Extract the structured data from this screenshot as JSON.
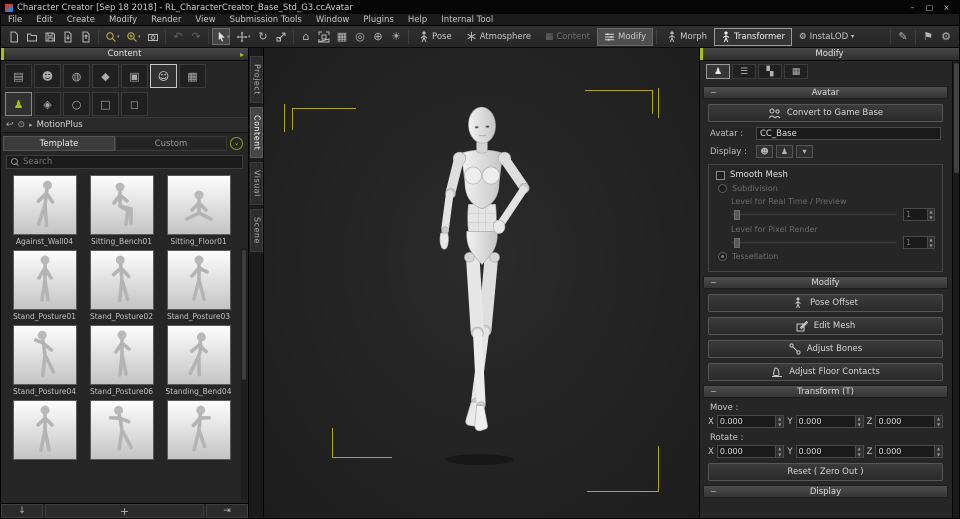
{
  "window": {
    "title": "Character Creator [Sep 18 2018] - RL_CharacterCreator_Base_Std_G3.ccAvatar",
    "controls": {
      "minimize": "–",
      "maximize": "▢",
      "close": "×"
    }
  },
  "menu": {
    "items": [
      "File",
      "Edit",
      "Create",
      "Modify",
      "Render",
      "View",
      "Submission Tools",
      "Window",
      "Plugins",
      "Help",
      "Internal Tool"
    ]
  },
  "toolbar": {
    "pose": "Pose",
    "atmosphere": "Atmosphere",
    "content": "Content",
    "modify": "Modify",
    "morph": "Morph",
    "transformer": "Transformer",
    "instalod": "InstaLOD"
  },
  "left_panel": {
    "header": "Content",
    "breadcrumb": "MotionPlus",
    "tabs": {
      "template": "Template",
      "custom": "Custom"
    },
    "search_placeholder": "Search",
    "items": [
      {
        "label": "Against_Wall04"
      },
      {
        "label": "Sitting_Bench01"
      },
      {
        "label": "Sitting_Floor01"
      },
      {
        "label": "Stand_Posture01"
      },
      {
        "label": "Stand_Posture02"
      },
      {
        "label": "Stand_Posture03"
      },
      {
        "label": "Stand_Posture04"
      },
      {
        "label": "Stand_Posture06"
      },
      {
        "label": "Standing_Bend04"
      },
      {
        "label": ""
      },
      {
        "label": ""
      },
      {
        "label": ""
      }
    ],
    "add_label": "+"
  },
  "side_tabs": {
    "items": [
      "Project",
      "Content",
      "Visual",
      "Scene"
    ]
  },
  "right_panel": {
    "header": "Modify",
    "avatar": {
      "title": "Avatar",
      "convert": "Convert to Game Base",
      "avatar_label": "Avatar :",
      "avatar_value": "CC_Base",
      "display_label": "Display :",
      "smooth_mesh": "Smooth Mesh",
      "subdivision": "Subdivision",
      "level_preview": "Level for Real Time / Preview",
      "level_preview_value": "1",
      "level_render": "Level for Pixel Render",
      "level_render_value": "1",
      "tessellation": "Tessellation"
    },
    "modify": {
      "title": "Modify",
      "pose_offset": "Pose Offset",
      "edit_mesh": "Edit Mesh",
      "adjust_bones": "Adjust Bones",
      "adjust_floor": "Adjust Floor Contacts"
    },
    "transform": {
      "title": "Transform  (T)",
      "move_label": "Move :",
      "rotate_label": "Rotate :",
      "x": "X",
      "y": "Y",
      "z": "Z",
      "move": [
        "0.000",
        "0.000",
        "0.000"
      ],
      "rotate": [
        "0.000",
        "0.000",
        "0.000"
      ],
      "reset": "Reset ( Zero Out )"
    },
    "display": {
      "title": "Display"
    }
  },
  "icons": {
    "undo": "↶",
    "redo": "↷",
    "rotate_tool": "↻",
    "home": "⌂",
    "sun": "☀",
    "target": "◎",
    "globe": "⊕",
    "grid": "▦",
    "caret_down": "▾",
    "back": "↩",
    "pin": "⊙",
    "chevron_circle": "⌄",
    "header_arrow": "▸",
    "minus": "−",
    "plus": "+",
    "download": "↓",
    "apply": "⇥",
    "gear": "⚙",
    "spin_up": "▲",
    "spin_down": "▼",
    "folder": "▤",
    "actor": "☻",
    "material": "◍",
    "cloth": "◆",
    "hair": "▣",
    "avatar_cat": "☺",
    "scene_cat": "▦",
    "pose_cat": "♟",
    "motion_cat": "◈",
    "hand_cat": "○",
    "face_cat": "□",
    "morph_cat": "◻",
    "tab_modify": "♟",
    "tab_attribute": "☰",
    "tab_material": "▚",
    "tab_texture": "▦",
    "display_opt1": "☻",
    "display_opt2": "♟",
    "display_opt3": "▾",
    "misc1": "✎",
    "misc2": "⚑",
    "misc3": "⚙"
  }
}
